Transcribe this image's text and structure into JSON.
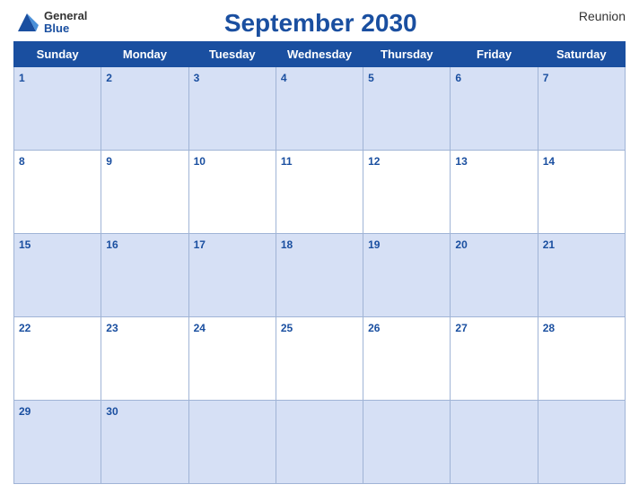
{
  "header": {
    "title": "September 2030",
    "region": "Reunion",
    "logo_general": "General",
    "logo_blue": "Blue"
  },
  "weekdays": [
    "Sunday",
    "Monday",
    "Tuesday",
    "Wednesday",
    "Thursday",
    "Friday",
    "Saturday"
  ],
  "weeks": [
    [
      {
        "day": 1,
        "active": true
      },
      {
        "day": 2,
        "active": true
      },
      {
        "day": 3,
        "active": true
      },
      {
        "day": 4,
        "active": true
      },
      {
        "day": 5,
        "active": true
      },
      {
        "day": 6,
        "active": true
      },
      {
        "day": 7,
        "active": true
      }
    ],
    [
      {
        "day": 8,
        "active": true
      },
      {
        "day": 9,
        "active": true
      },
      {
        "day": 10,
        "active": true
      },
      {
        "day": 11,
        "active": true
      },
      {
        "day": 12,
        "active": true
      },
      {
        "day": 13,
        "active": true
      },
      {
        "day": 14,
        "active": true
      }
    ],
    [
      {
        "day": 15,
        "active": true
      },
      {
        "day": 16,
        "active": true
      },
      {
        "day": 17,
        "active": true
      },
      {
        "day": 18,
        "active": true
      },
      {
        "day": 19,
        "active": true
      },
      {
        "day": 20,
        "active": true
      },
      {
        "day": 21,
        "active": true
      }
    ],
    [
      {
        "day": 22,
        "active": true
      },
      {
        "day": 23,
        "active": true
      },
      {
        "day": 24,
        "active": true
      },
      {
        "day": 25,
        "active": true
      },
      {
        "day": 26,
        "active": true
      },
      {
        "day": 27,
        "active": true
      },
      {
        "day": 28,
        "active": true
      }
    ],
    [
      {
        "day": 29,
        "active": true
      },
      {
        "day": 30,
        "active": true
      },
      {
        "day": null,
        "active": false
      },
      {
        "day": null,
        "active": false
      },
      {
        "day": null,
        "active": false
      },
      {
        "day": null,
        "active": false
      },
      {
        "day": null,
        "active": false
      }
    ]
  ],
  "colors": {
    "header_bg": "#1a4fa0",
    "odd_row_bg": "#d6e0f5",
    "even_row_bg": "#ffffff",
    "day_number_color": "#1a4fa0"
  }
}
